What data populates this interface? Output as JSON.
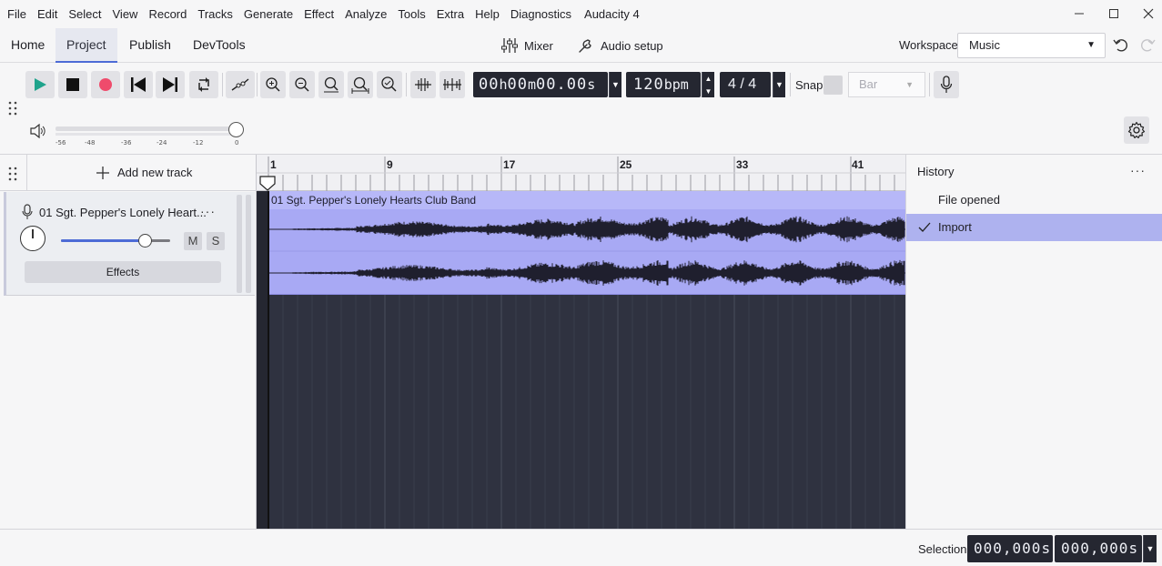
{
  "menu": {
    "items": [
      "File",
      "Edit",
      "Select",
      "View",
      "Record",
      "Tracks",
      "Generate",
      "Effect",
      "Analyze",
      "Tools",
      "Extra",
      "Help",
      "Diagnostics"
    ],
    "app_title": "Audacity 4"
  },
  "tabs": {
    "home": "Home",
    "project": "Project",
    "publish": "Publish",
    "devtools": "DevTools",
    "active": "Project"
  },
  "center_buttons": {
    "mixer": "Mixer",
    "audio_setup": "Audio setup"
  },
  "workspace": {
    "label": "Workspace",
    "value": "Music"
  },
  "toolbar": {
    "time": {
      "h": "00",
      "h_unit": "h",
      "m": "00",
      "m_unit": "m",
      "s": "00.00",
      "s_unit": "s"
    },
    "tempo": {
      "value": "120",
      "unit": "bpm"
    },
    "time_signature": "4 / 4",
    "snap_label": "Snap",
    "snap_value": "Bar",
    "meter_ticks": [
      "-56",
      "-48",
      "-36",
      "-24",
      "-12",
      "0"
    ]
  },
  "track_panel": {
    "add_track": "Add new track",
    "track_name": "01 Sgt. Pepper's Lonely Heart...",
    "mute": "M",
    "solo": "S",
    "effects": "Effects"
  },
  "timeline": {
    "ruler_labels": [
      "1",
      "9",
      "17",
      "25",
      "33",
      "41"
    ],
    "clip_name": "01 Sgt. Pepper's Lonely Hearts Club Band"
  },
  "history": {
    "title": "History",
    "items": [
      "File opened",
      "Import"
    ],
    "selected": "Import"
  },
  "status": {
    "selection_label": "Selection",
    "start": "000,000",
    "start_unit": "s",
    "end": "000,000",
    "end_unit": "s"
  },
  "colors": {
    "accent": "#4d6bd6",
    "play": "#1fa38c",
    "record": "#ef4b6c",
    "clip": "#a8a9f4",
    "clip_header": "#b7b8f8",
    "timeline_bg": "#2f3240",
    "history_selected": "#aeb2ef"
  }
}
